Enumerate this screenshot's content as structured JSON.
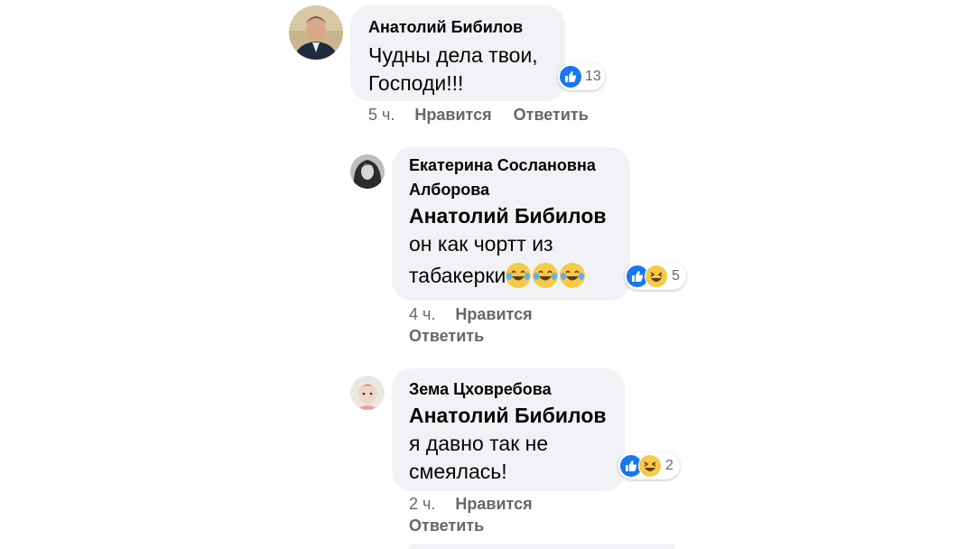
{
  "comments": [
    {
      "author": "Анатолий Бибилов",
      "text_line1": "Чудны дела твои,",
      "text_line2": "Господи!!!",
      "reaction_count": "13",
      "time": "5 ч.",
      "like_label": "Нравится",
      "reply_label": "Ответить"
    },
    {
      "author_line1": "Екатерина Сослановна",
      "author_line2": "Алборова",
      "mention": "Анатолий Бибилов",
      "text_line1": "он  как чортт из",
      "text_line2": "табакерки",
      "reaction_count": "5",
      "time": "4 ч.",
      "like_label": "Нравится",
      "reply_label": "Ответить"
    },
    {
      "author": "Зема Цховребова",
      "mention": "Анатолий Бибилов",
      "text_line1": "я давно так не",
      "text_line2": "смеялась!",
      "reaction_count": "2",
      "time": "2 ч.",
      "like_label": "Нравится",
      "reply_label": "Ответить"
    }
  ],
  "colors": {
    "bubble": "#f0f2f5",
    "like": "#1877f2",
    "haha": "#f7c948",
    "meta_text": "#65676b"
  },
  "icons": [
    "like-icon",
    "haha-icon",
    "tears-of-joy-emoji"
  ]
}
